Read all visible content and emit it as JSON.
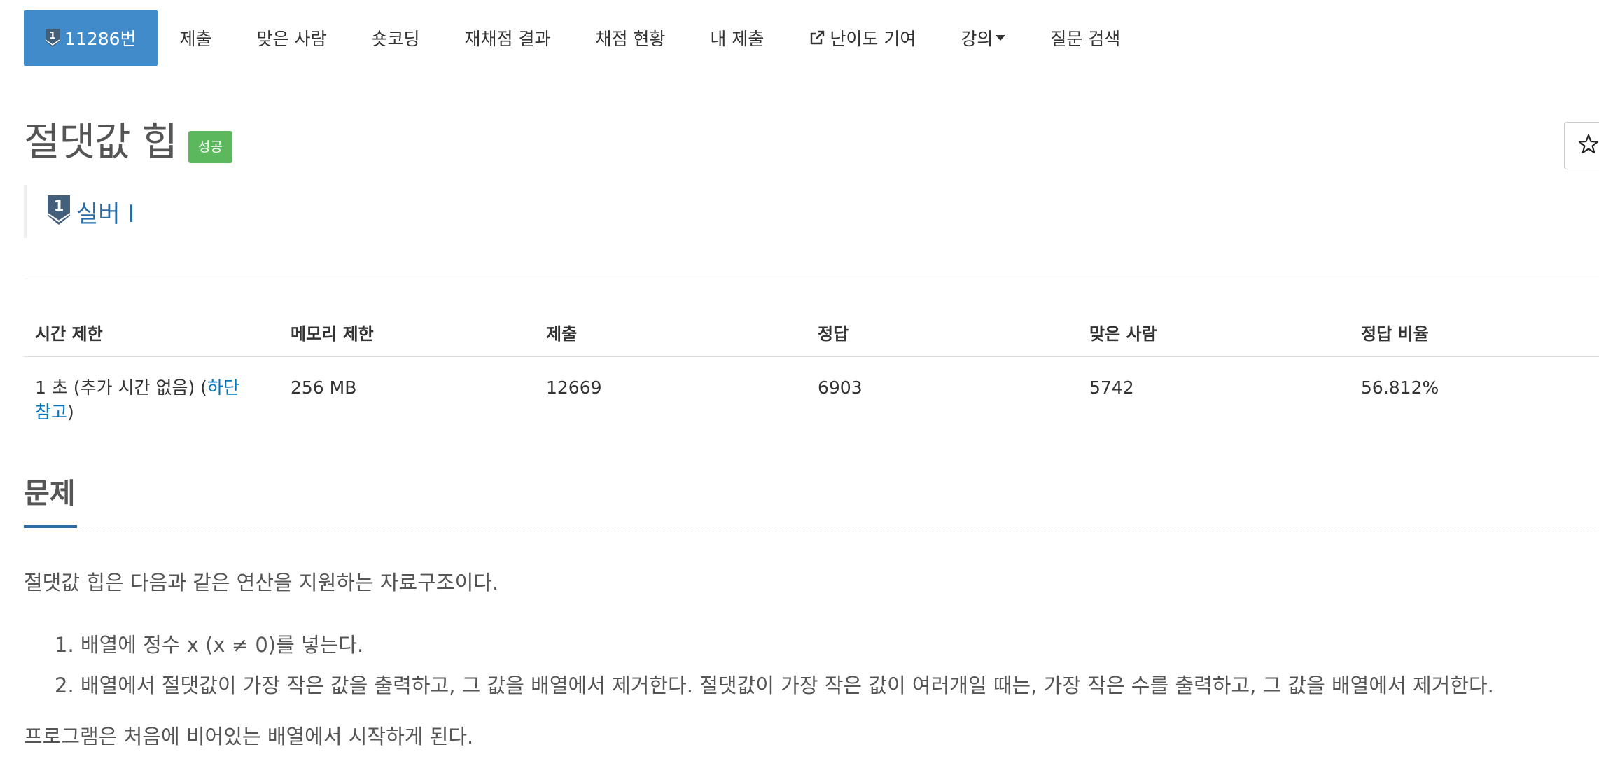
{
  "nav": {
    "problem_number": "11286번",
    "tabs": [
      "제출",
      "맞은 사람",
      "숏코딩",
      "재채점 결과",
      "채점 현황",
      "내 제출",
      "난이도 기여",
      "강의",
      "질문 검색"
    ]
  },
  "header": {
    "title": "절댓값 힙",
    "status_badge": "성공",
    "tier_level": "1",
    "tier_label": "실버 I"
  },
  "stats": {
    "headers": [
      "시간 제한",
      "메모리 제한",
      "제출",
      "정답",
      "맞은 사람",
      "정답 비율"
    ],
    "time_limit_prefix": "1 초 (추가 시간 없음) (",
    "time_limit_link": "하단 참고",
    "time_limit_suffix": ")",
    "memory_limit": "256 MB",
    "submissions": "12669",
    "accepted": "6903",
    "solvers": "5742",
    "ratio": "56.812%"
  },
  "problem": {
    "section_title": "문제",
    "intro": "절댓값 힙은 다음과 같은 연산을 지원하는 자료구조이다.",
    "items": [
      "1. 배열에 정수 x (x ≠ 0)를 넣는다.",
      "2. 배열에서 절댓값이 가장 작은 값을 출력하고, 그 값을 배열에서 제거한다. 절댓값이 가장 작은 값이 여러개일 때는, 가장 작은 수를 출력하고, 그 값을 배열에서 제거한다."
    ],
    "footer": "프로그램은 처음에 비어있는 배열에서 시작하게 된다."
  },
  "colors": {
    "primary": "#428bca",
    "success": "#5cb85c",
    "tier": "#2a6ca5",
    "link": "#0076c0"
  },
  "icons": {
    "tier": "silver-tier-shield-icon",
    "external": "external-link-icon",
    "star": "star-outline-icon",
    "dropdown": "caret-down-icon"
  }
}
